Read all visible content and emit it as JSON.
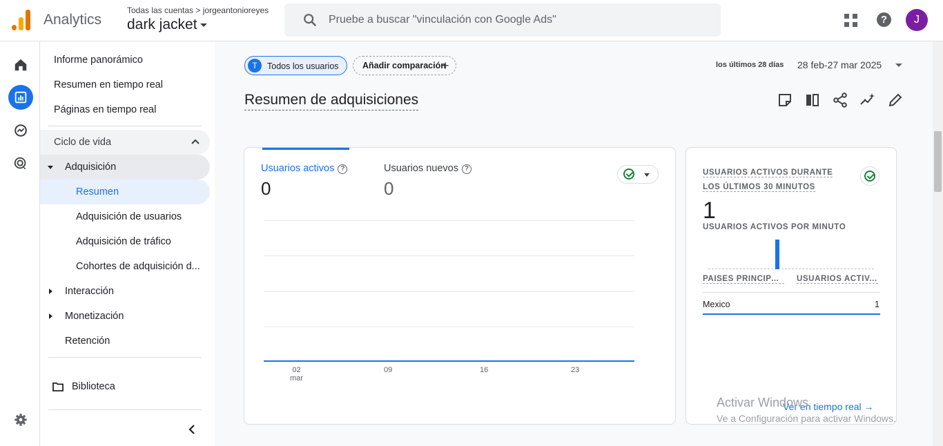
{
  "header": {
    "app_name": "Analytics",
    "account_path": "Todas las cuentas > jorgeantonioreyes",
    "property_name": "dark jacket",
    "search_placeholder": "Pruebe a buscar \"vinculación con Google Ads\"",
    "avatar_initial": "J",
    "help_glyph": "?"
  },
  "nav": {
    "items": {
      "overview": "Informe panorámico",
      "realtime_summary": "Resumen en tiempo real",
      "realtime_pages": "Páginas en tiempo real",
      "lifecycle": "Ciclo de vida",
      "acquisition": "Adquisición",
      "summary": "Resumen",
      "user_acquisition": "Adquisición de usuarios",
      "traffic_acquisition": "Adquisición de tráfico",
      "cohorts": "Cohortes de adquisición d...",
      "engagement": "Interacción",
      "monetization": "Monetización",
      "retention": "Retención",
      "library": "Biblioteca"
    }
  },
  "toolbar": {
    "segment_chip_initial": "T",
    "segment_chip": "Todos los usuarios",
    "add_comparison": "Añadir comparación",
    "date_caption": "los últimos 28 días",
    "date_range": "28 feb-27 mar 2025"
  },
  "page": {
    "title": "Resumen de adquisiciones"
  },
  "main_card": {
    "metric1_label": "Usuarios activos",
    "metric1_value": "0",
    "metric2_label": "Usuarios nuevos",
    "metric2_value": "0",
    "x_ticks": [
      "02\nmar",
      "09",
      "16",
      "23"
    ]
  },
  "chart_data": {
    "type": "line",
    "x": [
      "02 mar",
      "09",
      "16",
      "23"
    ],
    "series": [
      {
        "name": "Usuarios activos",
        "values": [
          0,
          0,
          0,
          0
        ]
      }
    ],
    "title": "",
    "xlabel": "",
    "ylabel": ""
  },
  "realtime_card": {
    "title": "USUARIOS ACTIVOS DURANTE LOS ÚLTIMOS 30 MINUTOS",
    "value": "1",
    "subtitle": "USUARIOS ACTIVOS POR MINUTO",
    "col_country": "PAÍSES PRINCIPA...",
    "col_users": "USUARIOS ACTIV...",
    "rows": [
      {
        "country": "Mexico",
        "users": "1"
      }
    ],
    "link": "Ver en tiempo real",
    "link_arrow": "→"
  },
  "watermark": {
    "line1": "Activar Windows",
    "line2": "Ve a Configuración para activar Windows."
  },
  "colors": {
    "accent": "#1a73e8",
    "active_bg": "#e8f0fe",
    "success": "#188038",
    "avatar": "#7b1fa2",
    "logo_orange": "#f9ab00",
    "logo_dark": "#e37400"
  }
}
